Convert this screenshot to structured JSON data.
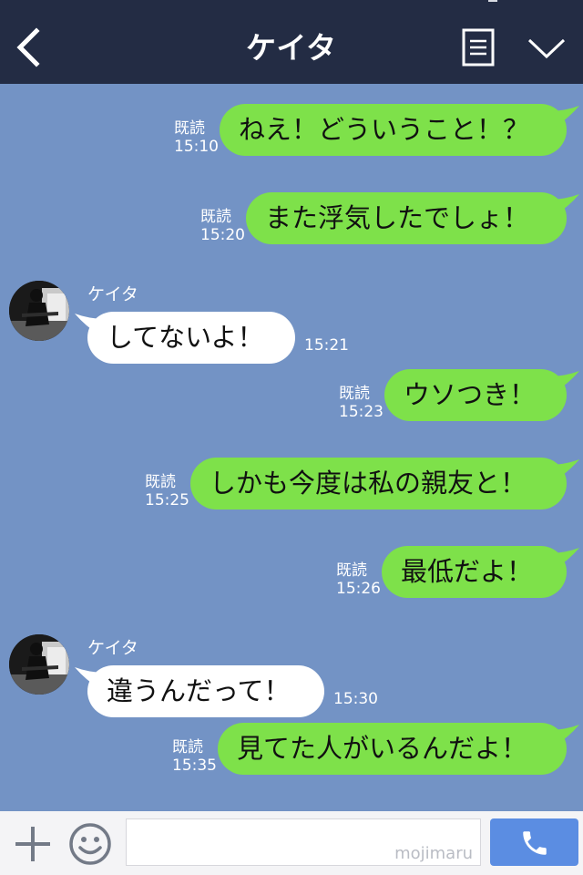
{
  "header": {
    "title": "ケイタ"
  },
  "colors": {
    "header_bg": "#232c44",
    "chat_bg": "#7393c5",
    "sent_bubble": "#7ee14a",
    "received_bubble": "#ffffff",
    "call_button": "#5b8de2"
  },
  "messages": [
    {
      "text": "ねえ！どういうこと！？",
      "read": "既読",
      "time": "15:10"
    },
    {
      "text": "また浮気したでしょ！",
      "read": "既読",
      "time": "15:20"
    },
    {
      "sender": "ケイタ",
      "text": "してないよ！",
      "time": "15:21"
    },
    {
      "text": "ウソつき！",
      "read": "既読",
      "time": "15:23"
    },
    {
      "text": "しかも今度は私の親友と！",
      "read": "既読",
      "time": "15:25"
    },
    {
      "text": "最低だよ！",
      "read": "既読",
      "time": "15:26"
    },
    {
      "sender": "ケイタ",
      "text": "違うんだって！",
      "time": "15:30"
    },
    {
      "text": "見てた人がいるんだよ！",
      "read": "既読",
      "time": "15:35"
    }
  ],
  "input": {
    "watermark": "mojimaru"
  }
}
